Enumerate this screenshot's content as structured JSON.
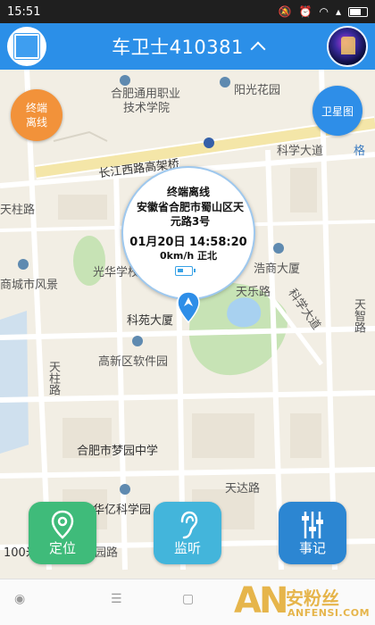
{
  "status_bar": {
    "time": "15:51"
  },
  "header": {
    "title": "车卫士410381"
  },
  "map": {
    "offline_button": "终端\n离线",
    "satellite_button": "卫星图",
    "labels": {
      "school1_line1": "合肥通用职业",
      "school1_line2": "技术学院",
      "yangguang": "阳光花园",
      "kexue": "科学大道",
      "gezhi": "格",
      "changjiang": "长江西路高架桥",
      "tianhe": "天柱路",
      "guanghua": "光华学校",
      "haokuang": "浩商大厦",
      "shangcheng": "商城市风景",
      "tianle": "天乐路",
      "keyuan": "科苑大厦",
      "tianzhi": "天智路",
      "kexue2": "科学大道",
      "gaoxin": "高新区软件园",
      "tianzhu": "天柱路",
      "mengyuan": "合肥市梦园中学",
      "tianda": "天达路",
      "huayi": "华亿科学园",
      "bottom_left": "100米",
      "road": "园路"
    }
  },
  "info_bubble": {
    "status": "终端离线",
    "address": "安徽省合肥市蜀山区天元路3号",
    "datetime": "01月20日 14:58:20",
    "speed": "0km/h  正北"
  },
  "actions": {
    "locate": "定位",
    "listen": "监听",
    "record": "事记"
  },
  "watermark": {
    "logo": "AN",
    "cn": "安粉丝",
    "en": "ANFENSI.COM"
  }
}
